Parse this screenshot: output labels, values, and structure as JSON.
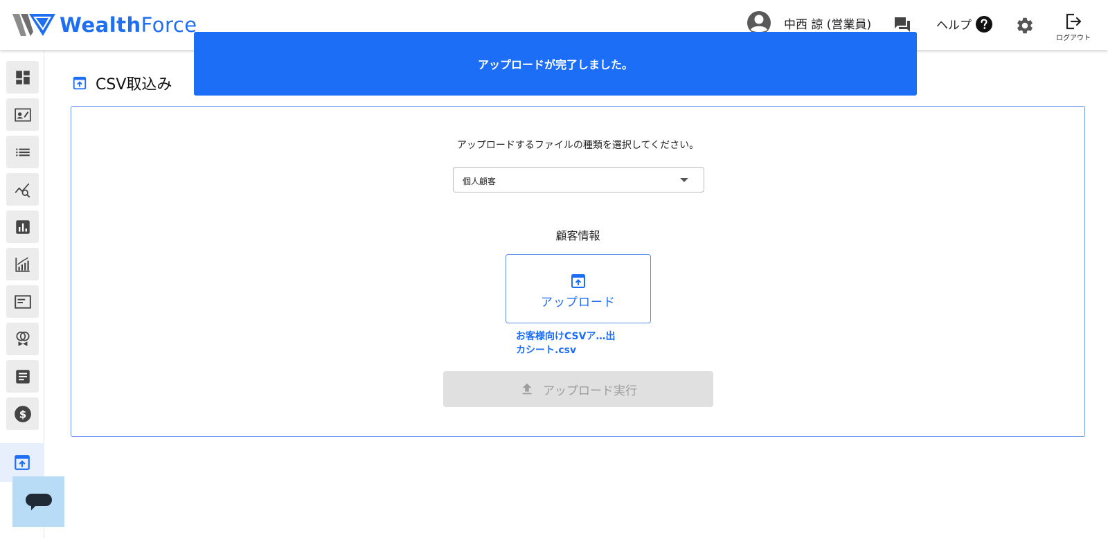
{
  "header": {
    "logo_text_bold": "Wealth",
    "logo_text_light": "Force",
    "user_name": "中西 諒 (営業員)",
    "help_label": "ヘルプ",
    "logout_label": "ログアウト"
  },
  "toast": {
    "message": "アップロードが完了しました。"
  },
  "page": {
    "title": "CSV取込み"
  },
  "form": {
    "instruction": "アップロードするファイルの種類を選択してください。",
    "file_type_selected": "個人顧客",
    "section_label": "顧客情報",
    "upload_label": "アップロード",
    "file_name": "お客様向けCSVア…出カシート.csv",
    "execute_label": "アップロード実行"
  },
  "colors": {
    "brand": "#1f6ff2",
    "toast_bg": "#1c6ef7",
    "active_nav_bg": "#e7eefc",
    "disabled_bg": "#e0e0e0"
  },
  "sidebar": {
    "icons": [
      "dashboard-icon",
      "contact-card-icon",
      "list-icon",
      "analytics-search-icon",
      "bar-chart-icon",
      "growth-chart-icon",
      "document-icon",
      "rings-icon",
      "article-icon",
      "dollar-icon",
      "upload-box-icon"
    ]
  }
}
